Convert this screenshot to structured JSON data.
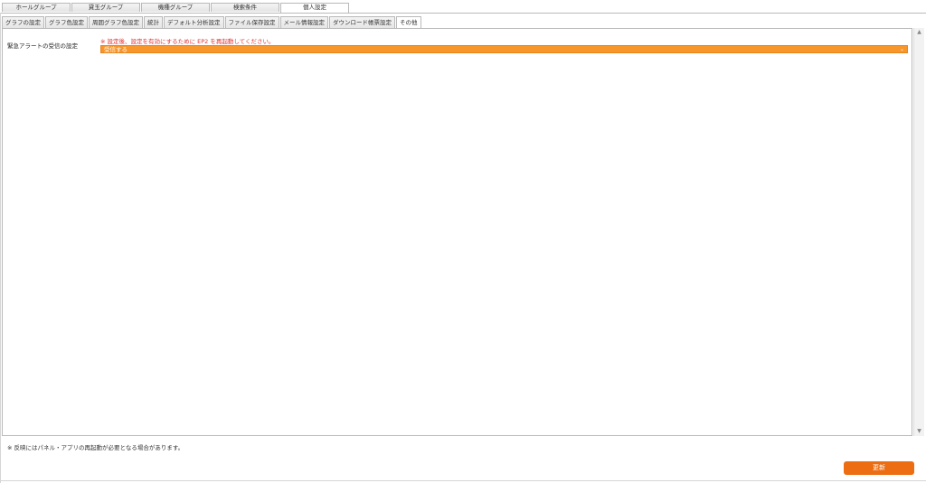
{
  "top_tabs": [
    {
      "label": "ホールグループ"
    },
    {
      "label": "貸玉グループ"
    },
    {
      "label": "機種グループ"
    },
    {
      "label": "検索条件"
    },
    {
      "label": "個人設定"
    }
  ],
  "active_top_tab": "個人設定",
  "sub_tabs": [
    {
      "label": "グラフの設定"
    },
    {
      "label": "グラフ色設定"
    },
    {
      "label": "周囲グラフ色設定"
    },
    {
      "label": "統計"
    },
    {
      "label": "デフォルト分析設定"
    },
    {
      "label": "ファイル保存設定"
    },
    {
      "label": "メール情報設定"
    },
    {
      "label": "ダウンロード帳票設定"
    },
    {
      "label": "その他"
    }
  ],
  "active_sub_tab": "その他",
  "settings": {
    "emergency_alert_label": "緊急アラートの受信の設定",
    "notice": "※ 設定後、設定を有効にするために EP2 を再起動してください。",
    "emergency_alert_value": "受信する",
    "dropdown_icon": "chevron-down-icon"
  },
  "footer": {
    "note": "※ 反映にはパネル・アプリの再起動が必要となる場合があります。",
    "update_button": "更新"
  },
  "colors": {
    "accent": "#f7962a",
    "button": "#ec6d12",
    "notice": "#e03030"
  }
}
